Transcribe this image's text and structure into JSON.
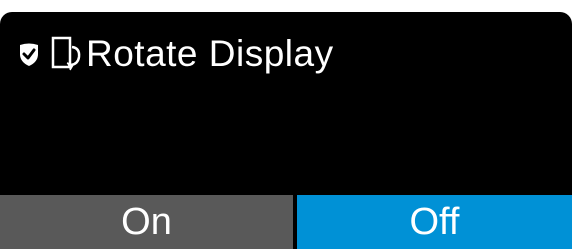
{
  "dialog": {
    "title": "Rotate Display",
    "icons": {
      "status": "shield-check-icon",
      "feature": "rotate-display-icon"
    }
  },
  "options": {
    "on_label": "On",
    "off_label": "Off",
    "selected": "Off"
  },
  "colors": {
    "background": "#000000",
    "unselected_button": "#595959",
    "selected_button": "#0091d6",
    "text": "#ffffff"
  }
}
